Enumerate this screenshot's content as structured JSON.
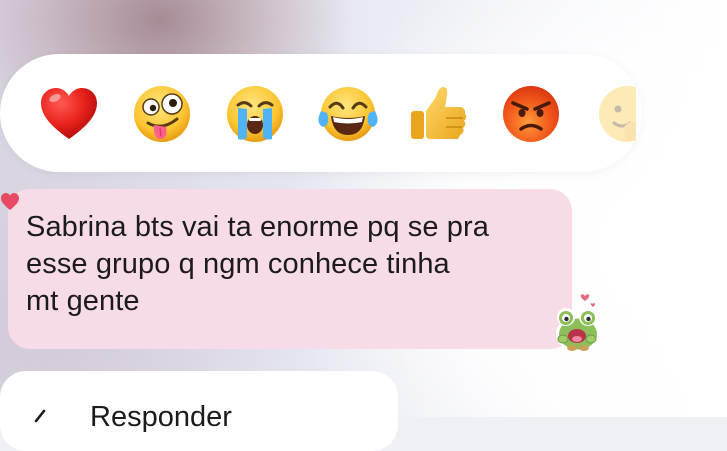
{
  "reactions": [
    {
      "name": "red-heart-icon"
    },
    {
      "name": "zany-face-icon"
    },
    {
      "name": "crying-face-icon"
    },
    {
      "name": "tears-of-joy-icon"
    },
    {
      "name": "thumbs-up-icon"
    },
    {
      "name": "angry-face-icon"
    },
    {
      "name": "more-reactions-icon"
    }
  ],
  "message": {
    "text": "Sabrina bts vai ta enorme pq se pra\nesse grupo q ngm conhece tinha\nmt gente",
    "bubble_color": "#f7dbe6",
    "reaction_badge": "heart-icon",
    "sticker": "frog-sticker-icon"
  },
  "menu": {
    "first_item_label": "Responder"
  }
}
